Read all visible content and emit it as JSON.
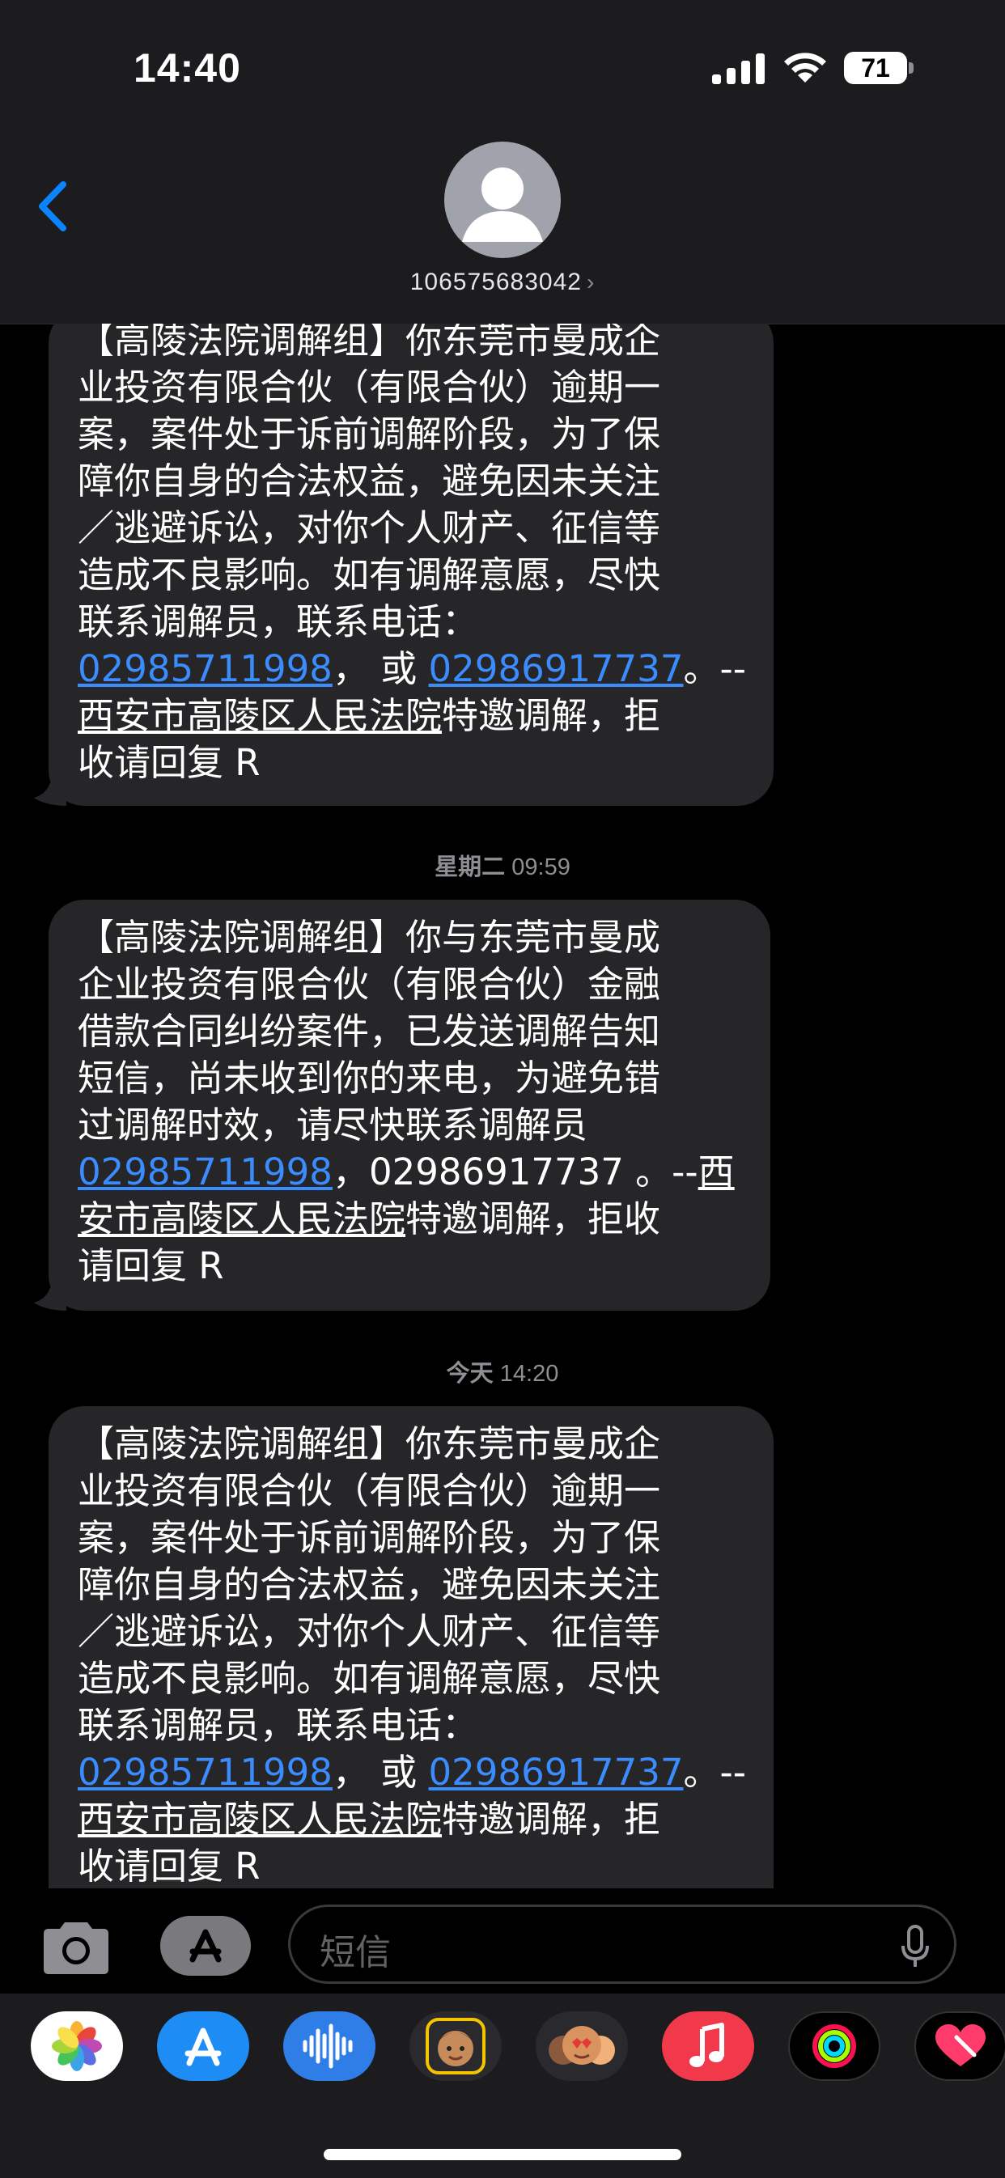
{
  "status_bar": {
    "time": "14:40",
    "battery": "71"
  },
  "header": {
    "contact_number": "106575683042",
    "chevron": "›"
  },
  "messages": [
    {
      "lines": [
        [
          {
            "t": "【高陵法院调解组】你东莞市曼成企"
          }
        ],
        [
          {
            "t": "业投资有限合伙（有限合伙）逾期一"
          }
        ],
        [
          {
            "t": "案，案件处于诉前调解阶段，为了保"
          }
        ],
        [
          {
            "t": "障你自身的合法权益，避免因未关注"
          }
        ],
        [
          {
            "t": "／逃避诉讼，对你个人财产、征信等"
          }
        ],
        [
          {
            "t": "造成不良影响。如有调解意愿，尽快"
          }
        ],
        [
          {
            "t": "联系调解员，联系电话："
          }
        ],
        [
          {
            "t": "02985711998",
            "link": true
          },
          {
            "t": "， 或 "
          },
          {
            "t": "02986917737",
            "link": true
          },
          {
            "t": "。--"
          }
        ],
        [
          {
            "t": "西安市高陵区人民法院",
            "u": true
          },
          {
            "t": "特邀调解，拒"
          }
        ],
        [
          {
            "t": "收请回复 R"
          }
        ]
      ]
    },
    {
      "lines": [
        [
          {
            "t": "【高陵法院调解组】你与东莞市曼成"
          }
        ],
        [
          {
            "t": "企业投资有限合伙（有限合伙）金融"
          }
        ],
        [
          {
            "t": "借款合同纠纷案件，已发送调解告知"
          }
        ],
        [
          {
            "t": "短信，尚未收到你的来电，为避免错"
          }
        ],
        [
          {
            "t": "过调解时效，请尽快联系调解员"
          }
        ],
        [
          {
            "t": "02985711998",
            "link": true
          },
          {
            "t": "，02986917737 。--"
          },
          {
            "t": "西",
            "u": true
          }
        ],
        [
          {
            "t": "安市高陵区人民法院",
            "u": true
          },
          {
            "t": "特邀调解，拒收"
          }
        ],
        [
          {
            "t": "请回复 R"
          }
        ]
      ]
    },
    {
      "lines": [
        [
          {
            "t": "【高陵法院调解组】你东莞市曼成企"
          }
        ],
        [
          {
            "t": "业投资有限合伙（有限合伙）逾期一"
          }
        ],
        [
          {
            "t": "案，案件处于诉前调解阶段，为了保"
          }
        ],
        [
          {
            "t": "障你自身的合法权益，避免因未关注"
          }
        ],
        [
          {
            "t": "／逃避诉讼，对你个人财产、征信等"
          }
        ],
        [
          {
            "t": "造成不良影响。如有调解意愿，尽快"
          }
        ],
        [
          {
            "t": "联系调解员，联系电话："
          }
        ],
        [
          {
            "t": "02985711998",
            "link": true
          },
          {
            "t": "， 或 "
          },
          {
            "t": "02986917737",
            "link": true
          },
          {
            "t": "。--"
          }
        ],
        [
          {
            "t": "西安市高陵区人民法院",
            "u": true
          },
          {
            "t": "特邀调解，拒"
          }
        ],
        [
          {
            "t": "收请回复 R"
          }
        ]
      ]
    }
  ],
  "timestamps": [
    {
      "day": "星期二",
      "time": "09:59"
    },
    {
      "day": "今天",
      "time": "14:20"
    }
  ],
  "input": {
    "placeholder": "短信"
  },
  "app_tray": [
    {
      "name": "photos-icon"
    },
    {
      "name": "app-store-icon"
    },
    {
      "name": "audio-message-icon"
    },
    {
      "name": "memoji-icon"
    },
    {
      "name": "memoji-stickers-icon"
    },
    {
      "name": "music-icon"
    },
    {
      "name": "fitness-icon"
    },
    {
      "name": "digital-touch-icon"
    }
  ],
  "colors": {
    "link": "#3a8cff",
    "bubble": "#262629",
    "header": "#1c1c1e",
    "accent": "#0a84ff"
  }
}
